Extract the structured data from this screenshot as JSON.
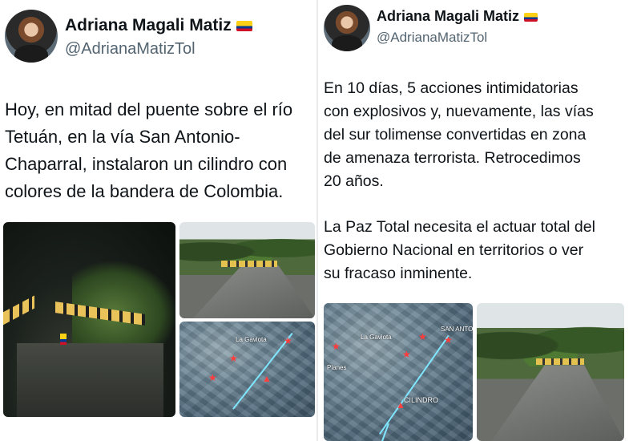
{
  "left": {
    "user": {
      "name": "Adriana Magali Matiz",
      "handle": "@AdrianaMatizTol"
    },
    "text": "Hoy, en mitad del puente sobre el río\nTetuán, en la vía San Antonio-\nChaparral, instalaron un cilindro con\ncolores de la bandera de Colombia."
  },
  "right": {
    "user": {
      "name": "Adriana Magali Matiz",
      "handle": "@AdrianaMatizTol"
    },
    "paragraph1": "En 10 días, 5 acciones intimidatorias\ncon explosivos y, nuevamente, las vías\ndel sur tolimense convertidas en zona\nde amenaza terrorista. Retrocedimos\n20 años.",
    "paragraph2": "La Paz Total necesita el actuar total del\nGobierno Nacional en territorios o ver\nsu fracaso inminente.",
    "map_labels": {
      "place1": "La Gaviota",
      "place2": "Planes",
      "place3": "CILINDRO",
      "place4": "SAN ANTONIO"
    }
  },
  "map_labels_left": {
    "place1": "La Gaviota"
  },
  "icons": {
    "flag": "colombia-flag-icon",
    "warning": "warning-icon",
    "marker": "star-marker-icon"
  },
  "colors": {
    "handle": "#536471",
    "divider": "#e9eaeb",
    "route": "#7fe7ff",
    "marker": "#ff3b3b"
  }
}
